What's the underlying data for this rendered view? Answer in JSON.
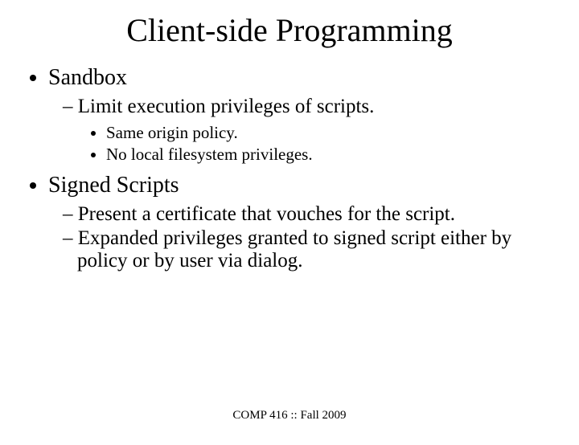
{
  "title": "Client-side Programming",
  "bullets": {
    "b1": "Sandbox",
    "b1_1": "Limit execution privileges of scripts.",
    "b1_1_a": "Same origin policy.",
    "b1_1_b": "No local filesystem privileges.",
    "b2": "Signed Scripts",
    "b2_1": "Present a certificate that vouches for the script.",
    "b2_2": "Expanded privileges granted to signed script either by policy or by user via dialog."
  },
  "footer": "COMP 416 :: Fall 2009"
}
